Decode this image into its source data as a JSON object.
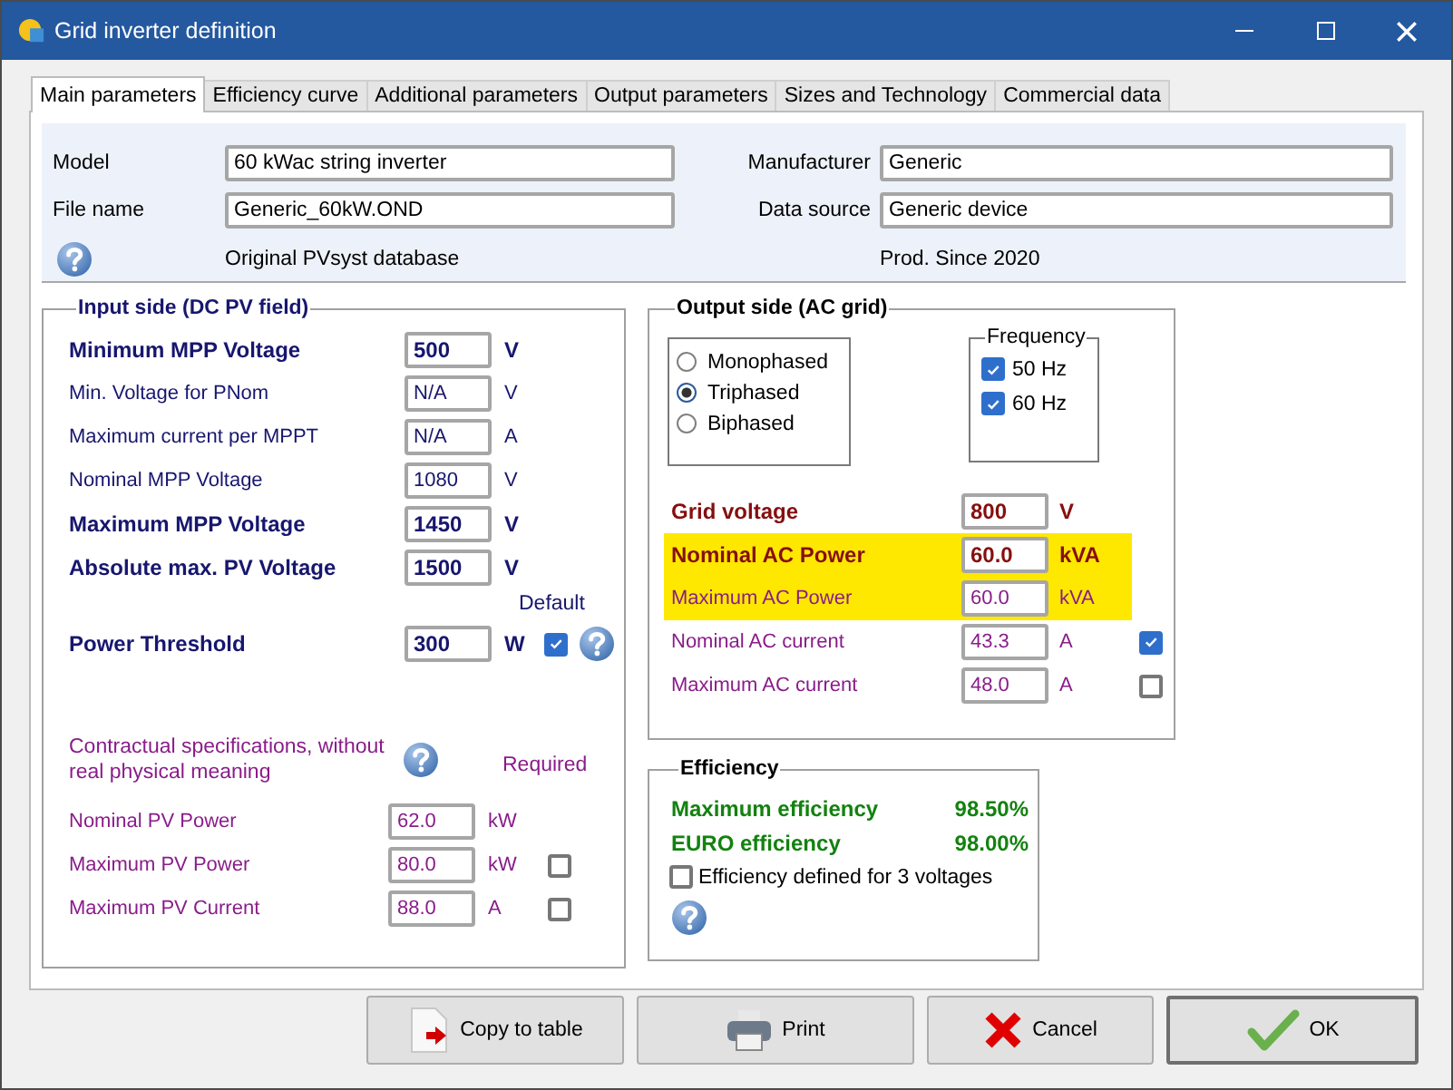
{
  "window": {
    "title": "Grid inverter definition"
  },
  "tabs": [
    {
      "label": "Main parameters",
      "selected": true
    },
    {
      "label": "Efficiency curve",
      "selected": false
    },
    {
      "label": "Additional parameters",
      "selected": false
    },
    {
      "label": "Output parameters",
      "selected": false
    },
    {
      "label": "Sizes and Technology",
      "selected": false
    },
    {
      "label": "Commercial data",
      "selected": false
    }
  ],
  "header": {
    "left": [
      {
        "label": "Model",
        "value": "60 kWac string inverter"
      },
      {
        "label": "File name",
        "value": "Generic_60kW.OND"
      }
    ],
    "right": [
      {
        "label": "Manufacturer",
        "value": "Generic"
      },
      {
        "label": "Data source",
        "value": "Generic device"
      }
    ],
    "database_note": "Original PVsyst database",
    "production_note": "Prod. Since 2020"
  },
  "input_side": {
    "title": "Input side (DC PV field)",
    "rows": [
      {
        "kind": "main",
        "label": "Minimum MPP Voltage",
        "value": "500",
        "unit": "V"
      },
      {
        "kind": "minor",
        "label": "Min. Voltage for PNom",
        "value": "N/A",
        "unit": "V"
      },
      {
        "kind": "minor",
        "label": "Maximum current per MPPT",
        "value": "N/A",
        "unit": "A"
      },
      {
        "kind": "minor",
        "label": "Nominal MPP Voltage",
        "value": "1080",
        "unit": "V"
      },
      {
        "kind": "main",
        "label": "Maximum MPP Voltage",
        "value": "1450",
        "unit": "V"
      },
      {
        "kind": "main",
        "label": "Absolute max. PV Voltage",
        "value": "1500",
        "unit": "V"
      }
    ],
    "threshold": {
      "label": "Power Threshold",
      "value": "300",
      "unit": "W",
      "default_label": "Default",
      "default_checked": true
    },
    "contract": {
      "note": "Contractual specifications, without real physical meaning",
      "required_label": "Required",
      "rows": [
        {
          "label": "Nominal PV Power",
          "value": "62.0",
          "unit": "kW"
        },
        {
          "label": "Maximum PV Power",
          "value": "80.0",
          "unit": "kW",
          "checked": false
        },
        {
          "label": "Maximum PV Current",
          "value": "88.0",
          "unit": "A",
          "checked": false
        }
      ]
    }
  },
  "output_side": {
    "title": "Output side (AC grid)",
    "phases": [
      {
        "label": "Monophased",
        "selected": false
      },
      {
        "label": "Triphased",
        "selected": true
      },
      {
        "label": "Biphased",
        "selected": false
      }
    ],
    "frequency": {
      "title": "Frequency",
      "options": [
        {
          "label": "50 Hz",
          "checked": true
        },
        {
          "label": "60 Hz",
          "checked": true
        }
      ]
    },
    "rows": [
      {
        "kind": "main",
        "label": "Grid voltage",
        "value": "800",
        "unit": "V",
        "highlighted": false
      },
      {
        "kind": "main",
        "label": "Nominal AC Power",
        "value": "60.0",
        "unit": "kVA",
        "highlighted": true
      },
      {
        "kind": "minor",
        "label": "Maximum AC Power",
        "value": "60.0",
        "unit": "kVA",
        "highlighted": true
      },
      {
        "kind": "minor",
        "label": "Nominal AC current",
        "value": "43.3",
        "unit": "A",
        "highlighted": false,
        "checked": true
      },
      {
        "kind": "minor",
        "label": "Maximum AC current",
        "value": "48.0",
        "unit": "A",
        "highlighted": false,
        "checked": false
      }
    ]
  },
  "efficiency": {
    "title": "Efficiency",
    "rows": [
      {
        "label": "Maximum efficiency",
        "value": "98.50%"
      },
      {
        "label": "EURO efficiency",
        "value": "98.00%"
      }
    ],
    "three_voltages": {
      "label": "Efficiency defined for 3 voltages",
      "checked": false
    }
  },
  "buttons": [
    {
      "kind": "copy",
      "label": "Copy to table"
    },
    {
      "kind": "print",
      "label": "Print"
    },
    {
      "kind": "cancel",
      "label": "Cancel"
    },
    {
      "kind": "ok",
      "label": "OK"
    }
  ]
}
